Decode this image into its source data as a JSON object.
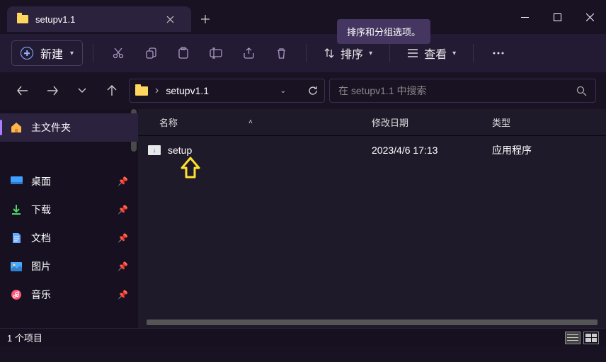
{
  "tab": {
    "title": "setupv1.1"
  },
  "tooltip": "排序和分组选项。",
  "toolbar": {
    "new_label": "新建",
    "sort_label": "排序",
    "view_label": "查看"
  },
  "breadcrumb": {
    "path": "setupv1.1"
  },
  "search": {
    "placeholder": "在 setupv1.1 中搜索"
  },
  "sidebar": {
    "home": "主文件夹",
    "items": [
      {
        "label": "桌面",
        "icon": "desktop",
        "color": "#40a0ff"
      },
      {
        "label": "下载",
        "icon": "download",
        "color": "#4fd66b"
      },
      {
        "label": "文档",
        "icon": "document",
        "color": "#6aa8ff"
      },
      {
        "label": "图片",
        "icon": "picture",
        "color": "#4aa8ff"
      },
      {
        "label": "音乐",
        "icon": "music",
        "color": "#ff5577"
      }
    ]
  },
  "columns": {
    "name": "名称",
    "date": "修改日期",
    "type": "类型"
  },
  "files": [
    {
      "name": "setup",
      "date": "2023/4/6 17:13",
      "type": "应用程序"
    }
  ],
  "status": "1 个项目"
}
